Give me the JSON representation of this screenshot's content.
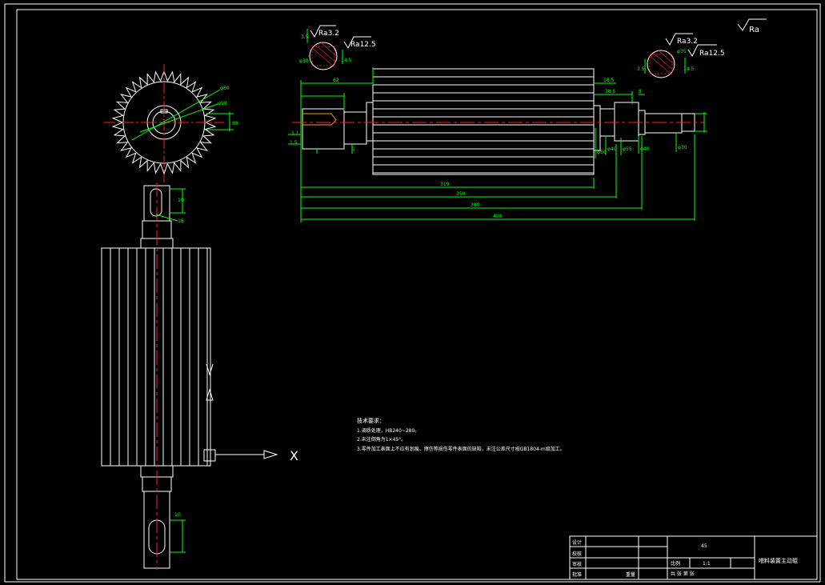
{
  "colors": {
    "background": "#000000",
    "outline": "#ffffff",
    "dimension": "#00ff00",
    "centerline": "#ff2020"
  },
  "roughness": {
    "general": "Ra",
    "left_keyway_bottom": "Ra3.2",
    "left_keyway_side": "Ra12.5",
    "right_keyway_bottom": "Ra3.2",
    "right_keyway_side": "Ra12.5",
    "left_section_dims": [
      "3.5",
      "φ30",
      "14.5"
    ],
    "right_section_dims": [
      "3.5",
      "φ35",
      "14.5"
    ]
  },
  "gear_view": {
    "dims": [
      "φ80",
      "φ98",
      "88"
    ],
    "lower_dims": [
      "10",
      "18"
    ]
  },
  "main_view": {
    "length_dims": [
      "319",
      "350",
      "380",
      "400"
    ],
    "top_dims": [
      "62",
      "18.5",
      "38.5",
      "8"
    ],
    "left_small_dims": [
      "1.1",
      "1.5",
      "1"
    ],
    "vertical_dims": [
      "φ50",
      "φ40",
      "φ55",
      "φ40",
      "φ30"
    ]
  },
  "arrow_label": "X",
  "notes": {
    "title": "技术要求：",
    "lines": [
      "1.调质处理，HB240~280。",
      "2.未注倒角为1×45°。",
      "3.零件加工表面上不应有划痕、擦伤等损伤零件表面的缺陷，未注公差尺寸按GB1804-m级加工。"
    ]
  },
  "title_block": {
    "rows": [
      "设计",
      "校核",
      "审核",
      "批准"
    ],
    "weight_label": "比例",
    "scale_value": "1:1",
    "material": "45",
    "sheet_info": "共 张 第 张",
    "material_label": "材料",
    "quantity_label": "重量",
    "drawing_title": "喂料装置主动辊"
  }
}
